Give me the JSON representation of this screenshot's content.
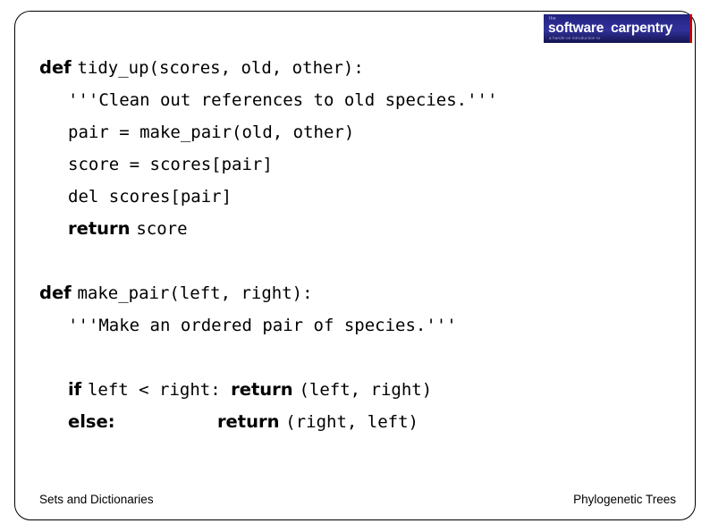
{
  "slide": {
    "logo": {
      "tiny_text": "the",
      "word1": "software",
      "word2": "carpentry",
      "subtext": "a hands-on introduction to",
      "bg_color": "#2b2b8f",
      "accent_color": "#c00000"
    },
    "code_lines": [
      {
        "indent": 0,
        "segments": [
          {
            "text": "def ",
            "bold": true
          },
          {
            "text": "tidy_up(scores, old, other):",
            "bold": false
          }
        ]
      },
      {
        "indent": 1,
        "segments": [
          {
            "text": "'''Clean out references to old species.'''",
            "bold": false
          }
        ]
      },
      {
        "indent": 1,
        "segments": [
          {
            "text": "pair = make_pair(old, other)",
            "bold": false
          }
        ]
      },
      {
        "indent": 1,
        "segments": [
          {
            "text": "score = scores[pair]",
            "bold": false
          }
        ]
      },
      {
        "indent": 1,
        "segments": [
          {
            "text": "del scores[pair]",
            "bold": false
          }
        ]
      },
      {
        "indent": 1,
        "segments": [
          {
            "text": "return ",
            "bold": true
          },
          {
            "text": "score",
            "bold": false
          }
        ]
      },
      {
        "indent": 0,
        "segments": [
          {
            "text": "",
            "bold": false
          }
        ]
      },
      {
        "indent": 0,
        "segments": [
          {
            "text": "def ",
            "bold": true
          },
          {
            "text": "make_pair(left, right):",
            "bold": false
          }
        ]
      },
      {
        "indent": 1,
        "segments": [
          {
            "text": "'''Make an ordered pair of species.'''",
            "bold": false
          }
        ]
      },
      {
        "indent": 0,
        "segments": [
          {
            "text": "",
            "bold": false
          }
        ]
      },
      {
        "indent": 1,
        "segments": [
          {
            "text": "if ",
            "bold": true
          },
          {
            "text": "left < right: ",
            "bold": false
          },
          {
            "text": "return ",
            "bold": true
          },
          {
            "text": "(left, right)",
            "bold": false
          }
        ]
      },
      {
        "indent": 1,
        "segments": [
          {
            "text": "else:",
            "bold": true
          },
          {
            "text": "          ",
            "bold": false
          },
          {
            "text": "return ",
            "bold": true
          },
          {
            "text": "(right, left)",
            "bold": false
          }
        ]
      }
    ],
    "footer": {
      "left": "Sets and Dictionaries",
      "right": "Phylogenetic Trees"
    }
  }
}
